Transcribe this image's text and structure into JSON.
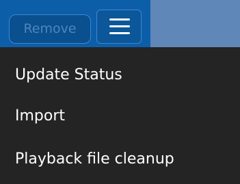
{
  "toolbar": {
    "remove_label": "Remove",
    "menu_icon": "hamburger-menu-icon"
  },
  "menu": {
    "items": [
      {
        "label": "Update Status"
      },
      {
        "label": "Import"
      },
      {
        "label": "Playback file cleanup"
      }
    ]
  },
  "colors": {
    "toolbar_background": "#0d5ea8",
    "menu_background": "#242424",
    "menu_text": "#ffffff",
    "disabled_button_text": "#4c86bf"
  }
}
